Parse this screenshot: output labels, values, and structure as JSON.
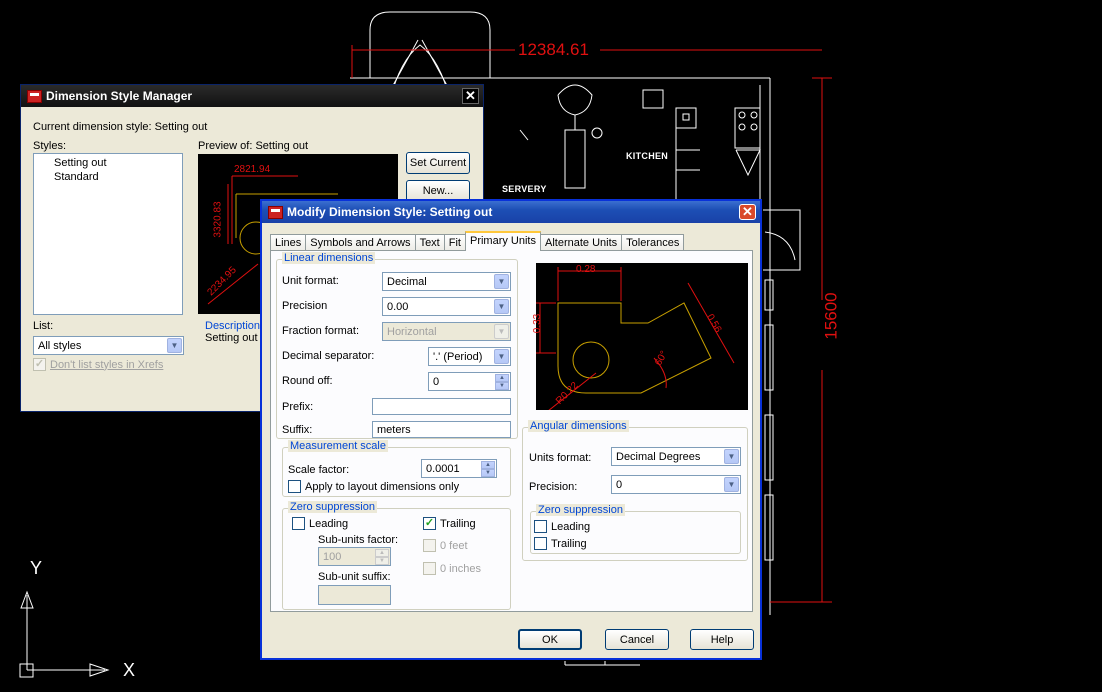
{
  "cad": {
    "dim_top": "12384.61",
    "dim_right": "15600",
    "rooms": [
      "KITCHEN",
      "SERVERY"
    ],
    "ucs_x": "X",
    "ucs_y": "Y",
    "colors": {
      "background": "#000000",
      "dimension": "#e01010",
      "geometry": "#ffffff"
    }
  },
  "dsm": {
    "title": "Dimension Style Manager",
    "current_style_label": "Current dimension style: Setting out",
    "styles_label": "Styles:",
    "styles": [
      "Setting out",
      "Standard"
    ],
    "preview_label": "Preview of: Setting out",
    "preview_dims": [
      "2821.94",
      "3320.83",
      "2234.95"
    ],
    "buttons": {
      "set_current": "Set Current",
      "new": "New..."
    },
    "list_label": "List:",
    "list_value": "All styles",
    "dont_list_xrefs": "Don't list styles in Xrefs",
    "description_label": "Description",
    "description_value": "Setting out"
  },
  "mds": {
    "title": "Modify Dimension Style: Setting out",
    "tabs": [
      {
        "label": "Lines",
        "active": false
      },
      {
        "label": "Symbols and Arrows",
        "active": false
      },
      {
        "label": "Text",
        "active": false
      },
      {
        "label": "Fit",
        "active": false
      },
      {
        "label": "Primary Units",
        "active": true
      },
      {
        "label": "Alternate Units",
        "active": false
      },
      {
        "label": "Tolerances",
        "active": false
      }
    ],
    "linear": {
      "group_title": "Linear dimensions",
      "unit_format_label": "Unit format:",
      "unit_format": "Decimal",
      "precision_label": "Precision",
      "precision": "0.00",
      "fraction_format_label": "Fraction format:",
      "fraction_format": "Horizontal",
      "decimal_separator_label": "Decimal separator:",
      "decimal_separator": "'.' (Period)",
      "round_off_label": "Round off:",
      "round_off": "0",
      "prefix_label": "Prefix:",
      "prefix": "",
      "suffix_label": "Suffix:",
      "suffix": "meters"
    },
    "measurement": {
      "group_title": "Measurement scale",
      "scale_factor_label": "Scale factor:",
      "scale_factor": "0.0001",
      "apply_layout_label": "Apply to layout dimensions only",
      "apply_layout_checked": false
    },
    "zero_linear": {
      "group_title": "Zero suppression",
      "leading_label": "Leading",
      "leading_checked": false,
      "trailing_label": "Trailing",
      "trailing_checked": true,
      "sub_units_factor_label": "Sub-units factor:",
      "sub_units_factor": "100",
      "feet_label": "0 feet",
      "inches_label": "0 inches",
      "sub_unit_suffix_label": "Sub-unit suffix:",
      "sub_unit_suffix": ""
    },
    "preview_dims": [
      "0.28",
      "0.33",
      "0.56",
      "60°",
      "R0.22"
    ],
    "angular": {
      "group_title": "Angular dimensions",
      "units_format_label": "Units format:",
      "units_format": "Decimal Degrees",
      "precision_label": "Precision:",
      "precision": "0",
      "zero_title": "Zero suppression",
      "leading_label": "Leading",
      "leading_checked": false,
      "trailing_label": "Trailing",
      "trailing_checked": false
    },
    "buttons": {
      "ok": "OK",
      "cancel": "Cancel",
      "help": "Help"
    }
  }
}
